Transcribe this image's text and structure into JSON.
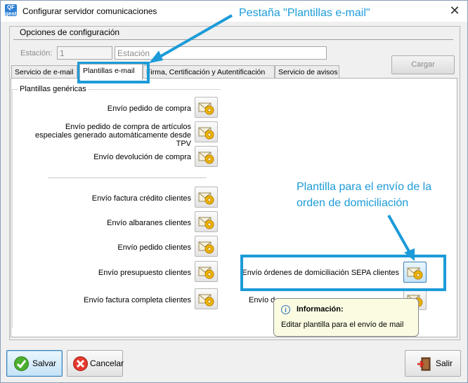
{
  "window": {
    "title": "Configurar servidor comunicaciones",
    "app_badge": "QF\ngest"
  },
  "group": {
    "title": "Opciones de configuración"
  },
  "estacion": {
    "label": "Estación:",
    "code": "1",
    "name": "Estación"
  },
  "cargar_label": "Cargar",
  "tabs": [
    {
      "label": "Servicio de e-mail"
    },
    {
      "label": "Plantillas e-mail"
    },
    {
      "label": "Firma, Certificación y Autentificación"
    },
    {
      "label": "Servicio de avisos"
    }
  ],
  "section": {
    "title": "Plantillas genéricas"
  },
  "templates_left": [
    {
      "label": "Envío pedido de compra"
    },
    {
      "label": "Envío pedido de compra de artículos especiales generado automáticamente desde TPV"
    },
    {
      "label": "Envío devolución de compra"
    },
    {
      "label": "Envío factura crédito clientes"
    },
    {
      "label": "Envío albaranes clientes"
    },
    {
      "label": "Envío pedido clientes"
    },
    {
      "label": "Envío presupuesto clientes"
    },
    {
      "label": "Envío factura completa clientes"
    }
  ],
  "templates_right": [
    {
      "label": "Envío órdenes de domiciliación SEPA clientes"
    },
    {
      "label": "Envío d..."
    }
  ],
  "tooltip": {
    "title": "Información:",
    "text": "Editar plantilla para el envío de mail"
  },
  "annotations": {
    "tab_note": "Pestaña \"Plantillas e-mail\"",
    "sepa_note_1": "Plantilla para el envío de la",
    "sepa_note_2": "orden de domiciliación"
  },
  "footer": {
    "save_label": "Salvar",
    "cancel_label": "Cancelar",
    "exit_label": "Salir"
  },
  "icons": {
    "template_button": "envelope-gear-icon",
    "save": "check-icon",
    "cancel": "cancel-icon",
    "exit": "exit-door-icon",
    "info": "info-icon"
  },
  "colors": {
    "annotation": "#1c9bd8",
    "tooltip_bg": "#fbfbe2"
  }
}
